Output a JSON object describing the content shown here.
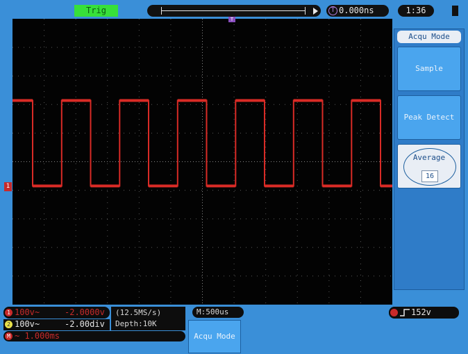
{
  "top": {
    "trig": "Trig",
    "h_position": "0.000ns",
    "clock": "1:36"
  },
  "menu": {
    "title": "Acqu Mode",
    "items": [
      {
        "label": "Sample"
      },
      {
        "label": "Peak Detect"
      },
      {
        "label": "Average",
        "value": "16"
      }
    ]
  },
  "status": {
    "ch1": {
      "volts": "100v~",
      "offset": "-2.0000v"
    },
    "ch2": {
      "volts": "100v~",
      "offset": "-2.00div"
    },
    "ch3": {
      "text": "~ 1.000ms"
    },
    "sample_rate": "(12.5MS/s)",
    "depth": "Depth:10K",
    "mem_length": "M:500us",
    "trigger_level": "152v"
  },
  "bottom_button": {
    "label": "Acqu Mode"
  },
  "waveform": {
    "color": "#d92b26",
    "high_level": 0.286,
    "low_level": 0.585,
    "grid_color": "#5a5a5a"
  }
}
